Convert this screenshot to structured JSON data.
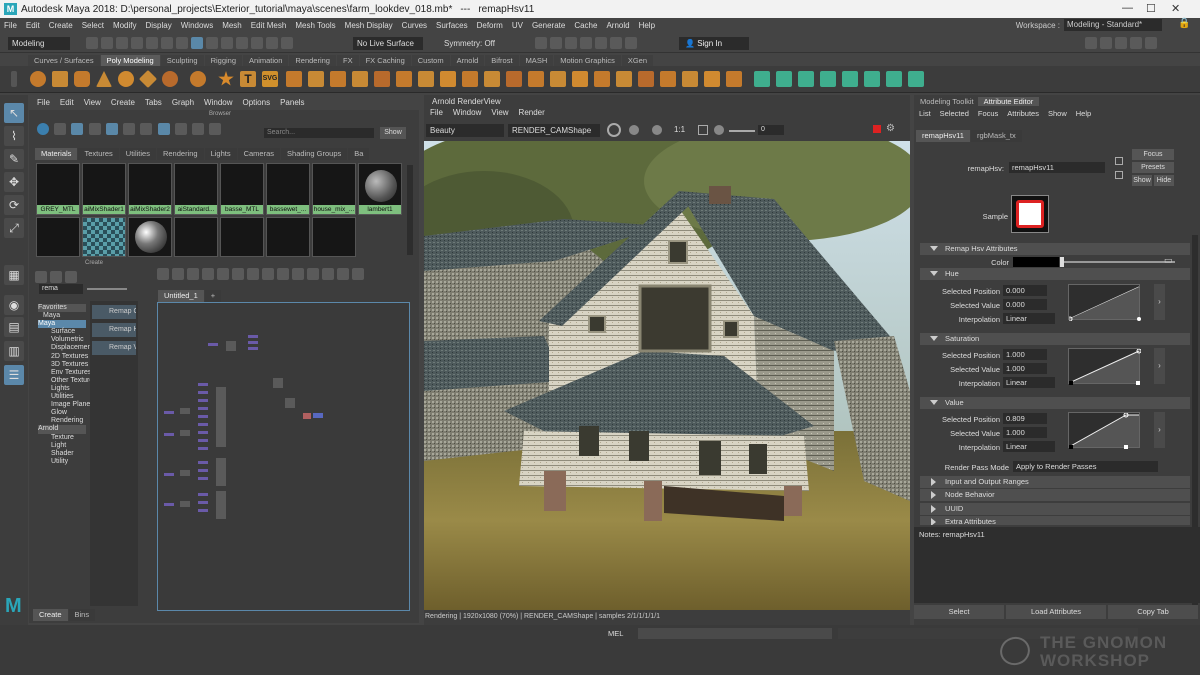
{
  "titlebar": {
    "app_title": "Autodesk Maya 2018: D:\\personal_projects\\Exterior_tutorial\\maya\\scenes\\farm_lookdev_018.mb*",
    "separator": "---",
    "node": "remapHsv11",
    "logo": "M"
  },
  "menubar": [
    "File",
    "Edit",
    "Create",
    "Select",
    "Modify",
    "Display",
    "Windows",
    "Mesh",
    "Edit Mesh",
    "Mesh Tools",
    "Mesh Display",
    "Curves",
    "Surfaces",
    "Deform",
    "UV",
    "Generate",
    "Cache",
    "Arnold",
    "Help"
  ],
  "workspace": {
    "label": "Workspace :",
    "value": "Modeling - Standard*"
  },
  "statusline": {
    "mode": "Modeling",
    "live_surface": "No Live Surface",
    "symmetry": "Symmetry: Off",
    "sign_in": "Sign In"
  },
  "shelf_tabs": [
    "Curves / Surfaces",
    "Poly Modeling",
    "Sculpting",
    "Rigging",
    "Animation",
    "Rendering",
    "FX",
    "FX Caching",
    "Custom",
    "Arnold",
    "Bifrost",
    "MASH",
    "Motion Graphics",
    "XGen"
  ],
  "shelf_active": "Poly Modeling",
  "hypershade": {
    "menu": [
      "File",
      "Edit",
      "View",
      "Create",
      "Tabs",
      "Graph",
      "Window",
      "Options",
      "Panels"
    ],
    "browser_title": "Browser",
    "search_placeholder": "Search...",
    "show_label": "Show",
    "browser_tabs": [
      "Materials",
      "Textures",
      "Utilities",
      "Rendering",
      "Lights",
      "Cameras",
      "Shading Groups",
      "Ba"
    ],
    "materials": [
      "GREY_MTL",
      "aiMixShader1",
      "aiMixShader2",
      "aiStandard...",
      "basse_MTL",
      "bassewet_...",
      "house_mix_...",
      "lambert1"
    ],
    "create_title": "Create",
    "create_search": "rema",
    "tree": [
      "Favorites",
      "Maya",
      "Surface",
      "Volumetric",
      "Displacement",
      "2D Textures",
      "3D Textures",
      "Env Textures",
      "Other Textures",
      "Lights",
      "Utilities",
      "Image Planes",
      "Glow",
      "Rendering",
      "Arnold",
      "Texture",
      "Light",
      "Shader",
      "Utility"
    ],
    "results": [
      "Remap Color",
      "Remap Hsv",
      "Remap Value"
    ],
    "graph_tab": "Untitled_1",
    "graph_add": "+",
    "bottom_tabs": [
      "Create",
      "Bins"
    ]
  },
  "renderview": {
    "title": "Arnold RenderView",
    "menu": [
      "File",
      "Window",
      "View",
      "Render"
    ],
    "aov": "Beauty",
    "camera": "RENDER_CAMShape",
    "ratio": "1:1",
    "exposure": "0",
    "status": "Rendering | 1920x1080 (70%) | RENDER_CAMShape | samples 2/1/1/1/1/1"
  },
  "attribute_editor": {
    "tabs": [
      "Modeling Toolkit",
      "Attribute Editor"
    ],
    "menu": [
      "List",
      "Selected",
      "Focus",
      "Attributes",
      "Show",
      "Help"
    ],
    "node_tabs": [
      "remapHsv11",
      "rgbMask_tx"
    ],
    "node_label": "remapHsv:",
    "node_name": "remapHsv11",
    "buttons": [
      "Focus",
      "Presets",
      "Show",
      "Hide"
    ],
    "sample_label": "Sample",
    "section_main": "Remap Hsv Attributes",
    "color_label": "Color",
    "groups": [
      {
        "name": "Hue",
        "position": "0.000",
        "value": "0.000",
        "interp": "Linear"
      },
      {
        "name": "Saturation",
        "position": "1.000",
        "value": "1.000",
        "interp": "Linear"
      },
      {
        "name": "Value",
        "position": "0.809",
        "value": "1.000",
        "interp": "Linear"
      }
    ],
    "field_labels": {
      "position": "Selected Position",
      "value": "Selected Value",
      "interp": "Interpolation"
    },
    "render_pass_label": "Render Pass Mode",
    "render_pass_value": "Apply to Render Passes",
    "collapsed": [
      "Input and Output Ranges",
      "Node Behavior",
      "UUID",
      "Extra Attributes"
    ],
    "notes": "Notes:  remapHsv11",
    "bottom_buttons": [
      "Select",
      "Load Attributes",
      "Copy Tab"
    ]
  },
  "commandline": {
    "label": "MEL"
  },
  "watermark": {
    "line1": "THE GNOMON",
    "line2": "WORKSHOP"
  },
  "colors": {
    "accent": "#5b88aa",
    "panel": "#3d3d3d",
    "material_label": "#7ebf7e"
  }
}
